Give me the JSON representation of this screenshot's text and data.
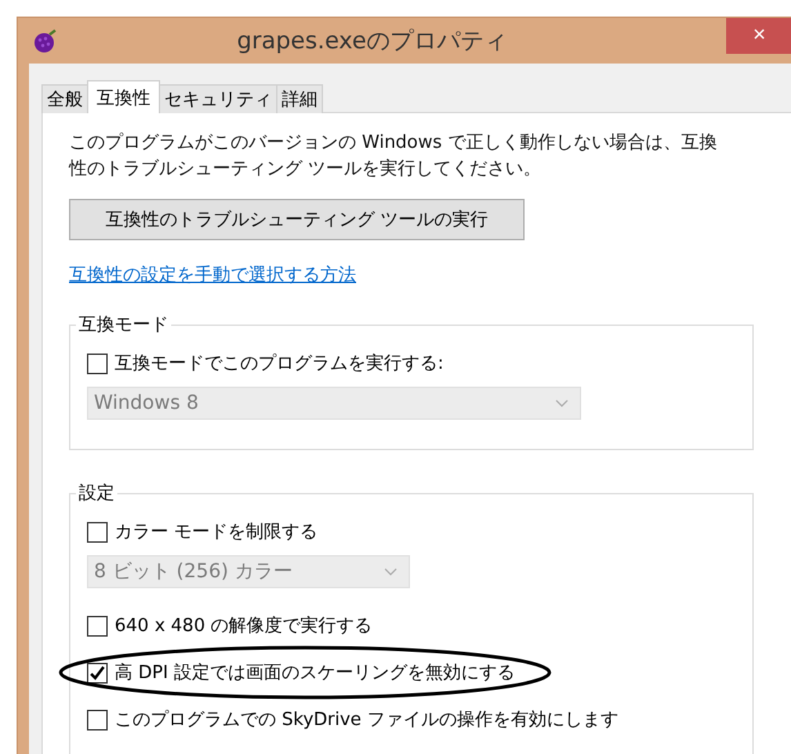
{
  "window": {
    "title": "grapes.exeのプロパティ",
    "close_label": "×"
  },
  "tabs": [
    {
      "label": "全般",
      "selected": false
    },
    {
      "label": "互換性",
      "selected": true
    },
    {
      "label": "セキュリティ",
      "selected": false
    },
    {
      "label": "詳細",
      "selected": false
    }
  ],
  "intro": "このプログラムがこのバージョンの Windows で正しく動作しない場合は、互換性のトラブルシューティング ツールを実行してください。",
  "troubleshoot_button": "互換性のトラブルシューティング ツールの実行",
  "manual_link": "互換性の設定を手動で選択する方法",
  "compat_group": {
    "title": "互換モード",
    "items": [
      {
        "kind": "checkbox",
        "label": "互換モードでこのプログラムを実行する:",
        "checked": false,
        "circled": false
      },
      {
        "kind": "select",
        "value": "Windows 8",
        "disabled": true
      }
    ]
  },
  "settings_group": {
    "title": "設定",
    "items": [
      {
        "kind": "checkbox",
        "label": "カラー モードを制限する",
        "checked": false,
        "circled": false
      },
      {
        "kind": "select",
        "value": "8 ビット (256) カラー",
        "disabled": true
      },
      {
        "kind": "checkbox",
        "label": "640 x 480 の解像度で実行する",
        "checked": false,
        "circled": false
      },
      {
        "kind": "checkbox",
        "label": "高 DPI 設定では画面のスケーリングを無効にする",
        "checked": true,
        "circled": true
      },
      {
        "kind": "checkbox",
        "label": "このプログラムでの SkyDrive ファイルの操作を有効にします",
        "checked": false,
        "circled": false
      }
    ]
  }
}
